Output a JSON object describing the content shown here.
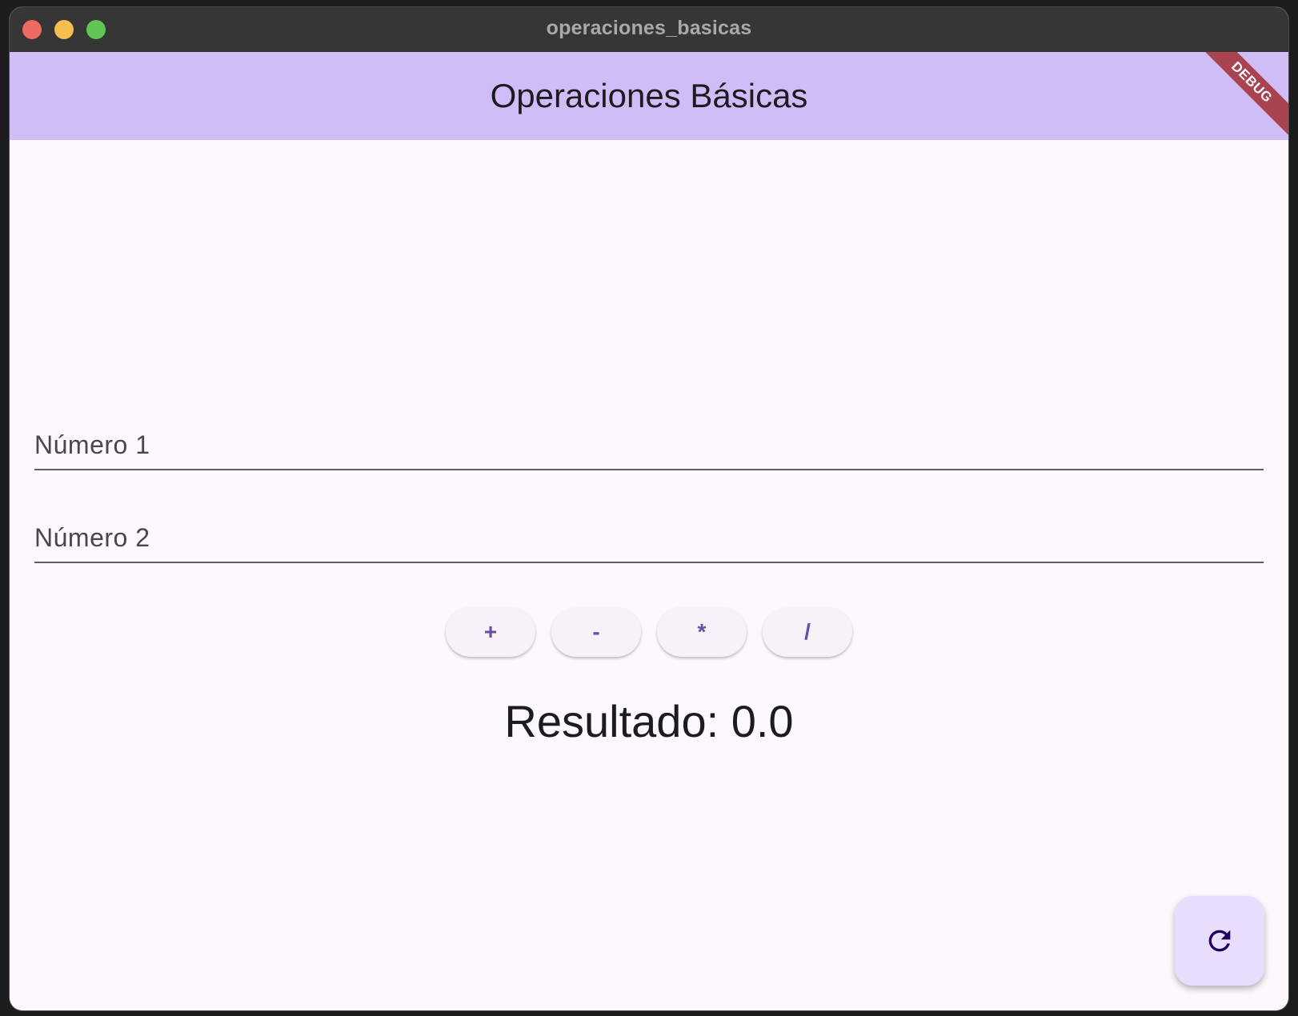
{
  "window": {
    "title": "operaciones_basicas"
  },
  "appbar": {
    "title": "Operaciones Básicas",
    "debug_label": "DEBUG"
  },
  "form": {
    "numero1_label": "Número 1",
    "numero1_value": "",
    "numero2_label": "Número 2",
    "numero2_value": ""
  },
  "operations": [
    {
      "label": "+"
    },
    {
      "label": "-"
    },
    {
      "label": "*"
    },
    {
      "label": "/"
    }
  ],
  "result": {
    "text": "Resultado: 0.0"
  },
  "fab": {
    "icon": "refresh-icon"
  },
  "colors": {
    "appbar": "#d0bcf6",
    "background": "#fdf7fe",
    "accent": "#6750a4",
    "fab": "#e8ddfc",
    "debug_banner": "#a3333a"
  }
}
